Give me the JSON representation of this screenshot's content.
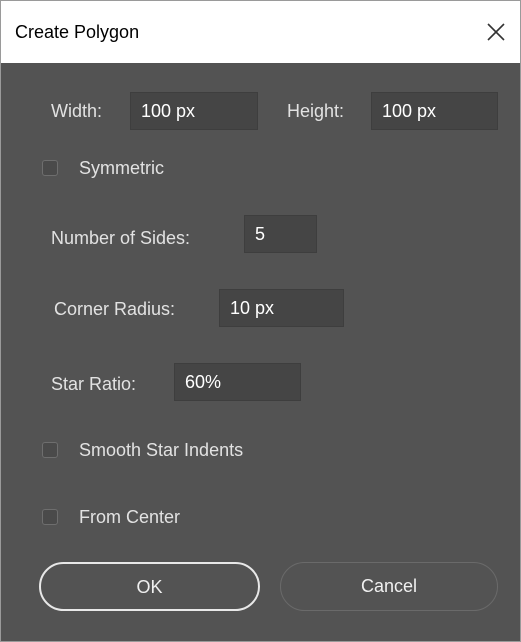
{
  "window": {
    "title": "Create Polygon",
    "close_icon": "close-icon"
  },
  "size": {
    "width_label": "Width:",
    "width_value": "100 px",
    "height_label": "Height:",
    "height_value": "100 px"
  },
  "options": {
    "symmetric_label": "Symmetric",
    "symmetric_checked": false,
    "sides_label": "Number of Sides:",
    "sides_value": "5",
    "corner_radius_label": "Corner Radius:",
    "corner_radius_value": "10 px",
    "star_ratio_label": "Star Ratio:",
    "star_ratio_value": "60%",
    "smooth_star_indents_label": "Smooth Star Indents",
    "smooth_star_indents_checked": false,
    "from_center_label": "From Center",
    "from_center_checked": false
  },
  "buttons": {
    "ok_label": "OK",
    "cancel_label": "Cancel"
  },
  "colors": {
    "dialog_background": "#535353",
    "field_background": "#454545",
    "text": "#e2e2e2",
    "title_bar": "#ffffff"
  }
}
